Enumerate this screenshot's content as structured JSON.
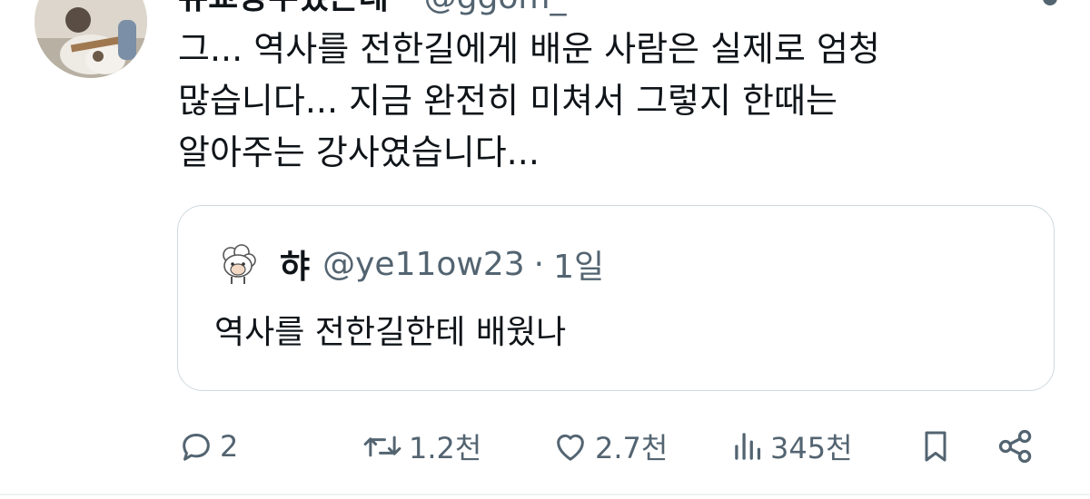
{
  "tweet": {
    "author": {
      "display_name": "유교광수했는데··",
      "handle": "@ggom_",
      "avatar_icon": "avatar-guitar-photo"
    },
    "text": "그... 역사를 전한길에게 배운 사람은 실제로 엄청\n많습니다... 지금 완전히 미쳐서 그렇지 한때는\n알아주는 강사였습니다...",
    "quote": {
      "author_name": "햐",
      "handle": "@ye11ow23",
      "separator": "·",
      "time": "1일",
      "text": "역사를 전한길한테 배웠나",
      "avatar_icon": "sheep-icon"
    },
    "actions": {
      "reply_count": "2",
      "retweet_count": "1.2천",
      "like_count": "2.7천",
      "view_count": "345천"
    }
  },
  "colors": {
    "text": "#0f1419",
    "secondary": "#536471",
    "border": "#cfd9de"
  }
}
